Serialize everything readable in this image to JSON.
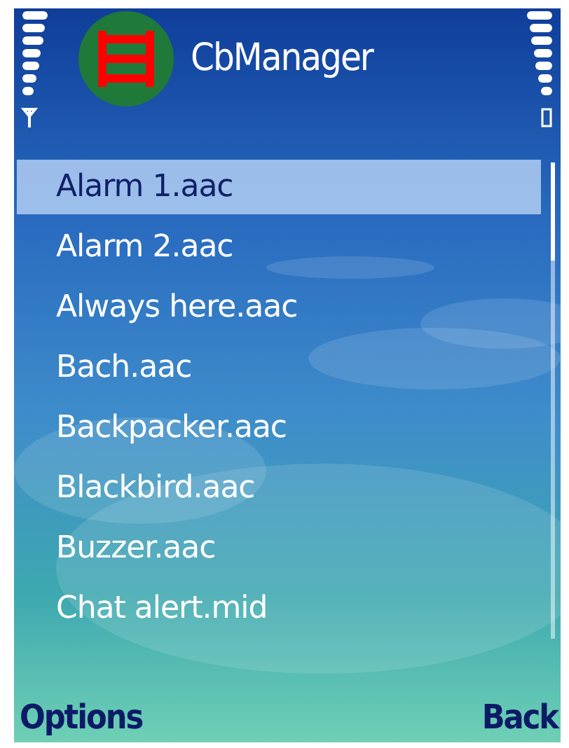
{
  "title_bar": {
    "title": "CbManager"
  },
  "list": {
    "items": [
      {
        "label": "Alarm 1.aac",
        "selected": true
      },
      {
        "label": "Alarm 2.aac",
        "selected": false
      },
      {
        "label": "Always here.aac",
        "selected": false
      },
      {
        "label": "Bach.aac",
        "selected": false
      },
      {
        "label": "Backpacker.aac",
        "selected": false
      },
      {
        "label": "Blackbird.aac",
        "selected": false
      },
      {
        "label": "Buzzer.aac",
        "selected": false
      },
      {
        "label": "Chat alert.mid",
        "selected": false
      }
    ]
  },
  "softkeys": {
    "left": "Options",
    "right": "Back"
  }
}
